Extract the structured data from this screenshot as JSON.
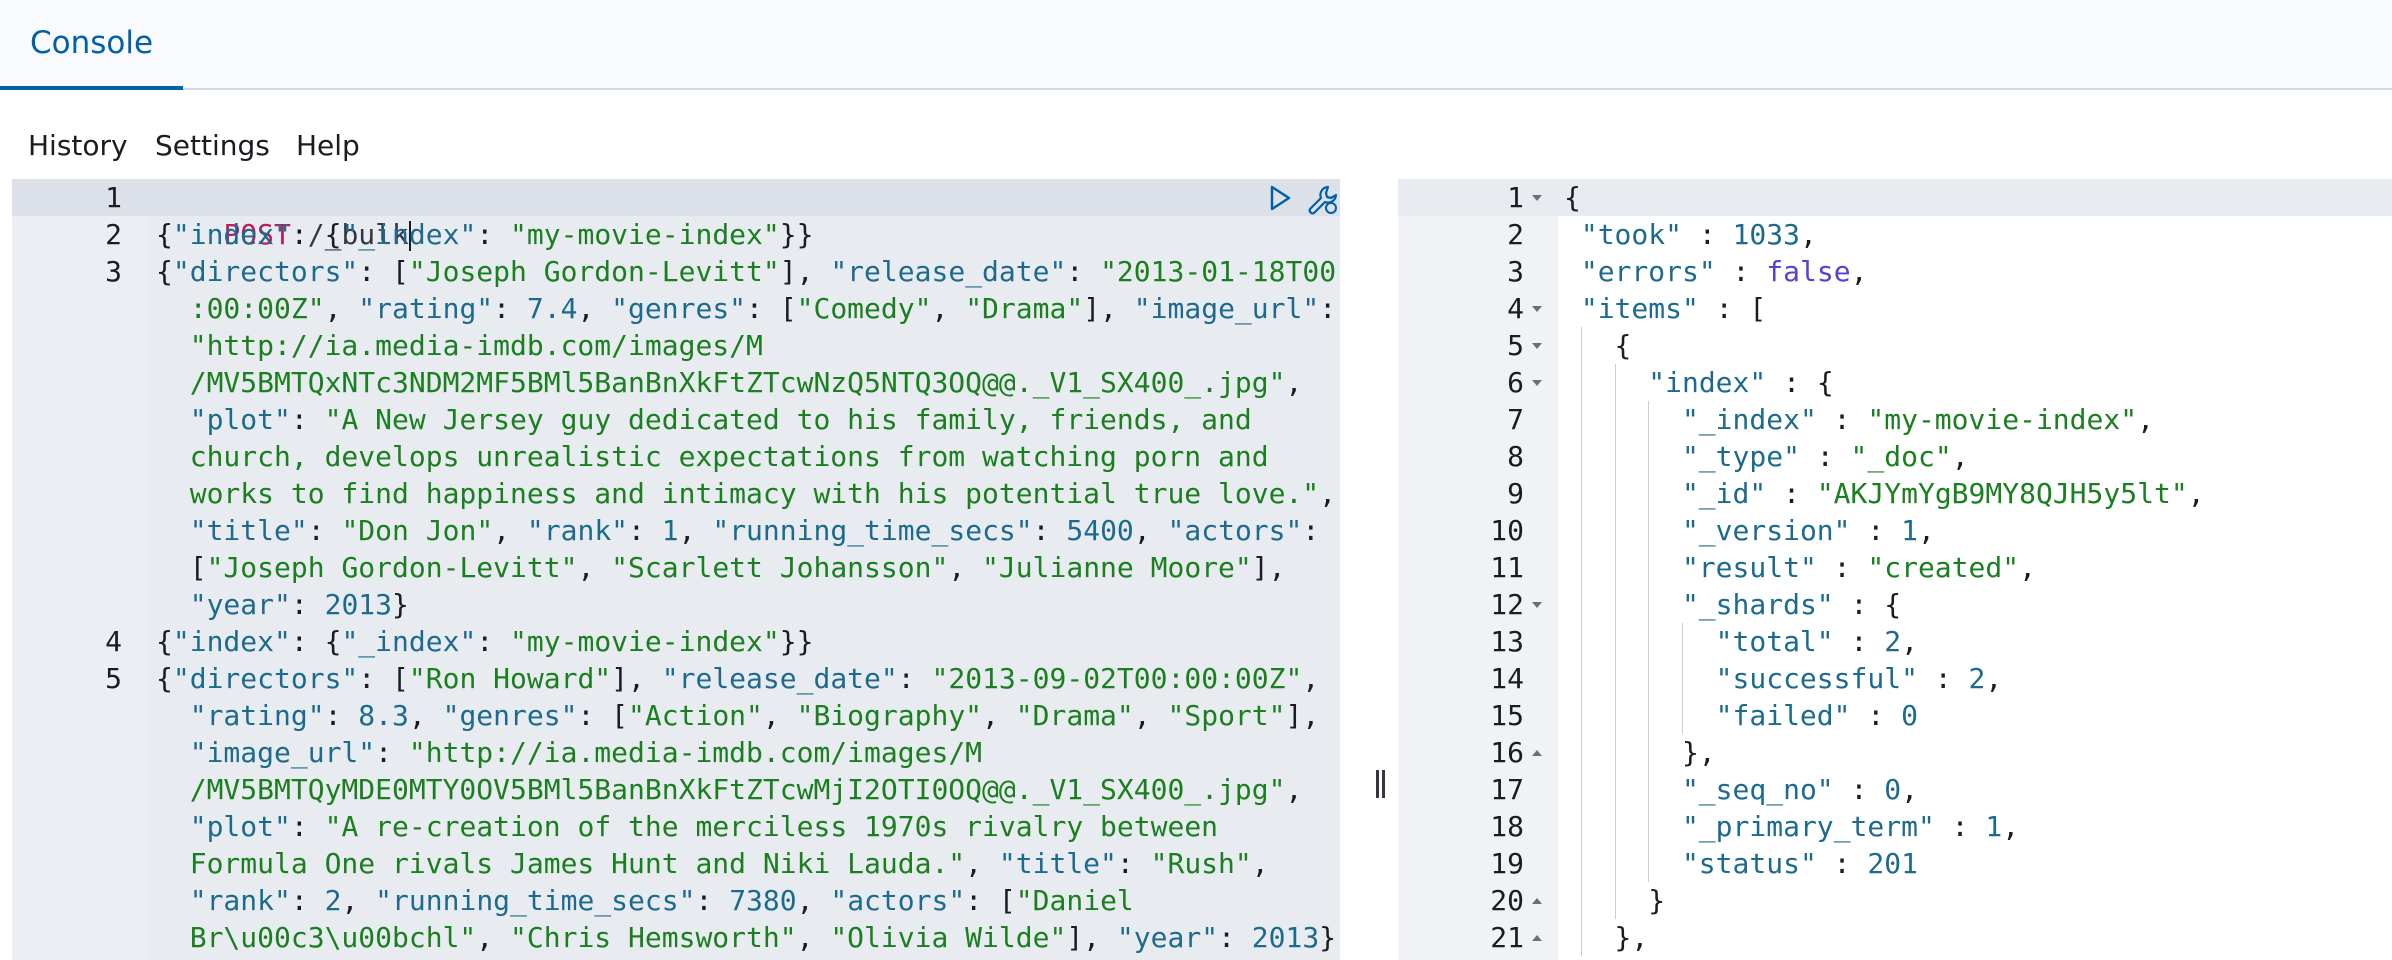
{
  "tabs": {
    "console": "Console"
  },
  "menu": {
    "history": "History",
    "settings": "Settings",
    "help": "Help"
  },
  "request": {
    "line_numbers": [
      "1",
      "2",
      "3",
      "4",
      "5"
    ],
    "method": "POST",
    "path": " /_bulk",
    "lines": [
      [
        [
          "punct",
          "{"
        ],
        [
          "key",
          "\"index\""
        ],
        [
          "punct",
          ": {"
        ],
        [
          "key",
          "\"_index\""
        ],
        [
          "punct",
          ": "
        ],
        [
          "str",
          "\"my-movie-index\""
        ],
        [
          "punct",
          "}}"
        ]
      ],
      [
        [
          "punct",
          "{"
        ],
        [
          "key",
          "\"directors\""
        ],
        [
          "punct",
          ": ["
        ],
        [
          "str",
          "\"Joseph Gordon-Levitt\""
        ],
        [
          "punct",
          "], "
        ],
        [
          "key",
          "\"release_date\""
        ],
        [
          "punct",
          ": "
        ],
        [
          "str",
          "\"2013-01-18T00"
        ]
      ],
      [
        [
          "str",
          "  :00:00Z\""
        ],
        [
          "punct",
          ", "
        ],
        [
          "key",
          "\"rating\""
        ],
        [
          "punct",
          ": "
        ],
        [
          "num",
          "7.4"
        ],
        [
          "punct",
          ", "
        ],
        [
          "key",
          "\"genres\""
        ],
        [
          "punct",
          ": ["
        ],
        [
          "str",
          "\"Comedy\""
        ],
        [
          "punct",
          ", "
        ],
        [
          "str",
          "\"Drama\""
        ],
        [
          "punct",
          "], "
        ],
        [
          "key",
          "\"image_url\""
        ],
        [
          "punct",
          ":"
        ]
      ],
      [
        [
          "str",
          "  \"http://ia.media-imdb.com/images/M"
        ]
      ],
      [
        [
          "str",
          "  /MV5BMTQxNTc3NDM2MF5BMl5BanBnXkFtZTcwNzQ5NTQ3OQ@@._V1_SX400_.jpg\""
        ],
        [
          "punct",
          ","
        ]
      ],
      [
        [
          "punct",
          "  "
        ],
        [
          "key",
          "\"plot\""
        ],
        [
          "punct",
          ": "
        ],
        [
          "str",
          "\"A New Jersey guy dedicated to his family, friends, and"
        ]
      ],
      [
        [
          "str",
          "  church, develops unrealistic expectations from watching porn and"
        ]
      ],
      [
        [
          "str",
          "  works to find happiness and intimacy with his potential true love.\""
        ],
        [
          "punct",
          ","
        ]
      ],
      [
        [
          "punct",
          "  "
        ],
        [
          "key",
          "\"title\""
        ],
        [
          "punct",
          ": "
        ],
        [
          "str",
          "\"Don Jon\""
        ],
        [
          "punct",
          ", "
        ],
        [
          "key",
          "\"rank\""
        ],
        [
          "punct",
          ": "
        ],
        [
          "num",
          "1"
        ],
        [
          "punct",
          ", "
        ],
        [
          "key",
          "\"running_time_secs\""
        ],
        [
          "punct",
          ": "
        ],
        [
          "num",
          "5400"
        ],
        [
          "punct",
          ", "
        ],
        [
          "key",
          "\"actors\""
        ],
        [
          "punct",
          ":"
        ]
      ],
      [
        [
          "punct",
          "  ["
        ],
        [
          "str",
          "\"Joseph Gordon-Levitt\""
        ],
        [
          "punct",
          ", "
        ],
        [
          "str",
          "\"Scarlett Johansson\""
        ],
        [
          "punct",
          ", "
        ],
        [
          "str",
          "\"Julianne Moore\""
        ],
        [
          "punct",
          "],"
        ]
      ],
      [
        [
          "punct",
          "  "
        ],
        [
          "key",
          "\"year\""
        ],
        [
          "punct",
          ": "
        ],
        [
          "num",
          "2013"
        ],
        [
          "punct",
          "}"
        ]
      ],
      [
        [
          "punct",
          "{"
        ],
        [
          "key",
          "\"index\""
        ],
        [
          "punct",
          ": {"
        ],
        [
          "key",
          "\"_index\""
        ],
        [
          "punct",
          ": "
        ],
        [
          "str",
          "\"my-movie-index\""
        ],
        [
          "punct",
          "}}"
        ]
      ],
      [
        [
          "punct",
          "{"
        ],
        [
          "key",
          "\"directors\""
        ],
        [
          "punct",
          ": ["
        ],
        [
          "str",
          "\"Ron Howard\""
        ],
        [
          "punct",
          "], "
        ],
        [
          "key",
          "\"release_date\""
        ],
        [
          "punct",
          ": "
        ],
        [
          "str",
          "\"2013-09-02T00:00:00Z\""
        ],
        [
          "punct",
          ","
        ]
      ],
      [
        [
          "punct",
          "  "
        ],
        [
          "key",
          "\"rating\""
        ],
        [
          "punct",
          ": "
        ],
        [
          "num",
          "8.3"
        ],
        [
          "punct",
          ", "
        ],
        [
          "key",
          "\"genres\""
        ],
        [
          "punct",
          ": ["
        ],
        [
          "str",
          "\"Action\""
        ],
        [
          "punct",
          ", "
        ],
        [
          "str",
          "\"Biography\""
        ],
        [
          "punct",
          ", "
        ],
        [
          "str",
          "\"Drama\""
        ],
        [
          "punct",
          ", "
        ],
        [
          "str",
          "\"Sport\""
        ],
        [
          "punct",
          "],"
        ]
      ],
      [
        [
          "punct",
          "  "
        ],
        [
          "key",
          "\"image_url\""
        ],
        [
          "punct",
          ": "
        ],
        [
          "str",
          "\"http://ia.media-imdb.com/images/M"
        ]
      ],
      [
        [
          "str",
          "  /MV5BMTQyMDE0MTY0OV5BMl5BanBnXkFtZTcwMjI2OTI0OQ@@._V1_SX400_.jpg\""
        ],
        [
          "punct",
          ","
        ]
      ],
      [
        [
          "punct",
          "  "
        ],
        [
          "key",
          "\"plot\""
        ],
        [
          "punct",
          ": "
        ],
        [
          "str",
          "\"A re-creation of the merciless 1970s rivalry between"
        ]
      ],
      [
        [
          "str",
          "  Formula One rivals James Hunt and Niki Lauda.\""
        ],
        [
          "punct",
          ", "
        ],
        [
          "key",
          "\"title\""
        ],
        [
          "punct",
          ": "
        ],
        [
          "str",
          "\"Rush\""
        ],
        [
          "punct",
          ","
        ]
      ],
      [
        [
          "punct",
          "  "
        ],
        [
          "key",
          "\"rank\""
        ],
        [
          "punct",
          ": "
        ],
        [
          "num",
          "2"
        ],
        [
          "punct",
          ", "
        ],
        [
          "key",
          "\"running_time_secs\""
        ],
        [
          "punct",
          ": "
        ],
        [
          "num",
          "7380"
        ],
        [
          "punct",
          ", "
        ],
        [
          "key",
          "\"actors\""
        ],
        [
          "punct",
          ": ["
        ],
        [
          "str",
          "\"Daniel"
        ]
      ],
      [
        [
          "str",
          "  Br\\u00c3\\u00bchl\""
        ],
        [
          "punct",
          ", "
        ],
        [
          "str",
          "\"Chris Hemsworth\""
        ],
        [
          "punct",
          ", "
        ],
        [
          "str",
          "\"Olivia Wilde\""
        ],
        [
          "punct",
          "], "
        ],
        [
          "key",
          "\"year\""
        ],
        [
          "punct",
          ": "
        ],
        [
          "num",
          "2013"
        ],
        [
          "punct",
          "}"
        ]
      ]
    ]
  },
  "response": {
    "line_numbers": [
      "1",
      "2",
      "3",
      "4",
      "5",
      "6",
      "7",
      "8",
      "9",
      "10",
      "11",
      "12",
      "13",
      "14",
      "15",
      "16",
      "17",
      "18",
      "19",
      "20",
      "21"
    ],
    "lines": [
      [
        [
          "punct",
          "{"
        ]
      ],
      [
        [
          "key",
          "\"took\""
        ],
        [
          "punct",
          " : "
        ],
        [
          "num",
          "1033"
        ],
        [
          "punct",
          ","
        ]
      ],
      [
        [
          "key",
          "\"errors\""
        ],
        [
          "punct",
          " : "
        ],
        [
          "bool",
          "false"
        ],
        [
          "punct",
          ","
        ]
      ],
      [
        [
          "key",
          "\"items\""
        ],
        [
          "punct",
          " : ["
        ]
      ],
      [
        [
          "punct",
          "{"
        ]
      ],
      [
        [
          "key",
          "\"index\""
        ],
        [
          "punct",
          " : {"
        ]
      ],
      [
        [
          "key",
          "\"_index\""
        ],
        [
          "punct",
          " : "
        ],
        [
          "str",
          "\"my-movie-index\""
        ],
        [
          "punct",
          ","
        ]
      ],
      [
        [
          "key",
          "\"_type\""
        ],
        [
          "punct",
          " : "
        ],
        [
          "str",
          "\"_doc\""
        ],
        [
          "punct",
          ","
        ]
      ],
      [
        [
          "key",
          "\"_id\""
        ],
        [
          "punct",
          " : "
        ],
        [
          "str",
          "\"AKJYmYgB9MY8QJH5y5lt\""
        ],
        [
          "punct",
          ","
        ]
      ],
      [
        [
          "key",
          "\"_version\""
        ],
        [
          "punct",
          " : "
        ],
        [
          "num",
          "1"
        ],
        [
          "punct",
          ","
        ]
      ],
      [
        [
          "key",
          "\"result\""
        ],
        [
          "punct",
          " : "
        ],
        [
          "str",
          "\"created\""
        ],
        [
          "punct",
          ","
        ]
      ],
      [
        [
          "key",
          "\"_shards\""
        ],
        [
          "punct",
          " : {"
        ]
      ],
      [
        [
          "key",
          "\"total\""
        ],
        [
          "punct",
          " : "
        ],
        [
          "num",
          "2"
        ],
        [
          "punct",
          ","
        ]
      ],
      [
        [
          "key",
          "\"successful\""
        ],
        [
          "punct",
          " : "
        ],
        [
          "num",
          "2"
        ],
        [
          "punct",
          ","
        ]
      ],
      [
        [
          "key",
          "\"failed\""
        ],
        [
          "punct",
          " : "
        ],
        [
          "num",
          "0"
        ]
      ],
      [
        [
          "punct",
          "},"
        ]
      ],
      [
        [
          "key",
          "\"_seq_no\""
        ],
        [
          "punct",
          " : "
        ],
        [
          "num",
          "0"
        ],
        [
          "punct",
          ","
        ]
      ],
      [
        [
          "key",
          "\"_primary_term\""
        ],
        [
          "punct",
          " : "
        ],
        [
          "num",
          "1"
        ],
        [
          "punct",
          ","
        ]
      ],
      [
        [
          "key",
          "\"status\""
        ],
        [
          "punct",
          " : "
        ],
        [
          "num",
          "201"
        ]
      ],
      [
        [
          "punct",
          "}"
        ]
      ],
      [
        [
          "punct",
          "},"
        ]
      ]
    ],
    "folds": [
      "down",
      "",
      "",
      "down",
      "down",
      "down",
      "",
      "",
      "",
      "",
      "",
      "down",
      "",
      "",
      "",
      "up",
      "",
      "",
      "",
      "up",
      "up"
    ]
  },
  "icons": {
    "send": "play-icon",
    "wrench": "wrench-icon",
    "resizer": "resize-handle-icon"
  }
}
